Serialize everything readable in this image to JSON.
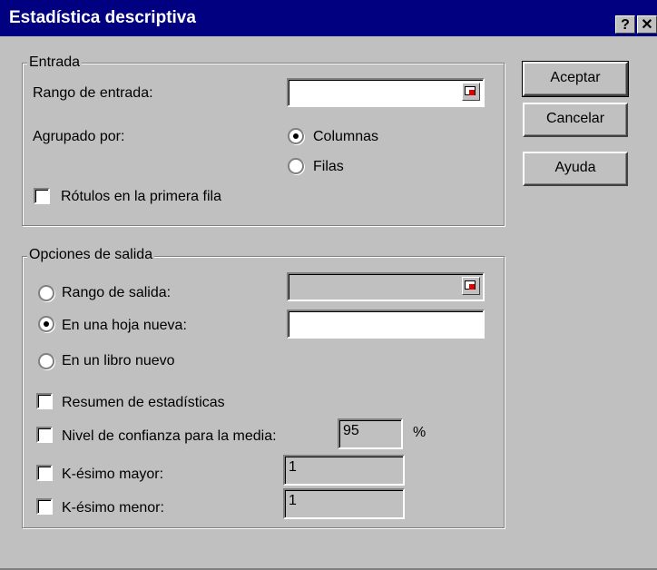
{
  "window": {
    "title": "Estadística descriptiva",
    "help_glyph": "?",
    "close_glyph": "✕"
  },
  "input_group": {
    "legend": "Entrada",
    "range_label": "Rango de entrada:",
    "range_value": "",
    "grouped_label": "Agrupado por:",
    "columns_label": "Columnas",
    "rows_label": "Filas",
    "grouped_selected": "Columnas",
    "labels_checkbox": "Rótulos en la primera fila",
    "labels_checked": false
  },
  "output_group": {
    "legend": "Opciones de salida",
    "output_range_label": "Rango de salida:",
    "new_sheet_label": "En una hoja nueva:",
    "new_book_label": "En un libro nuevo",
    "selected": "En una hoja nueva:",
    "summary_label": "Resumen de estadísticas",
    "confidence_label": "Nivel de confianza para la media:",
    "confidence_value": "95",
    "percent_sign": "%",
    "kth_largest_label": "K-ésimo mayor:",
    "kth_largest_value": "1",
    "kth_smallest_label": "K-ésimo menor:",
    "kth_smallest_value": "1"
  },
  "buttons": {
    "ok": "Aceptar",
    "cancel": "Cancelar",
    "help": "Ayuda"
  }
}
